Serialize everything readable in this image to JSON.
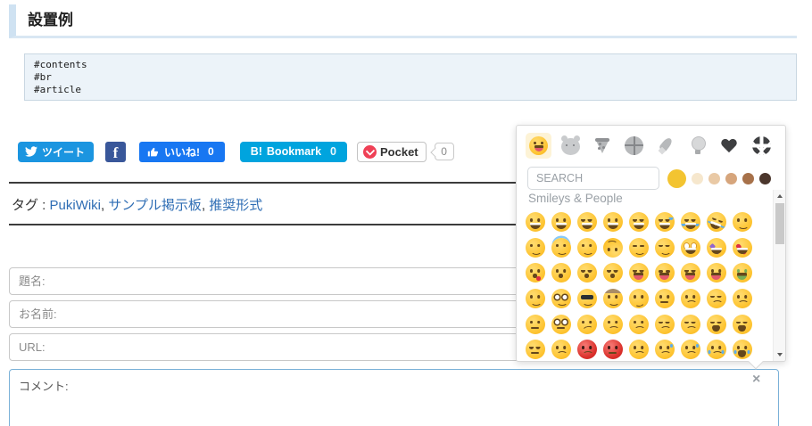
{
  "page": {
    "title": "設置例"
  },
  "code_block": {
    "lines": [
      "#contents",
      "#br",
      "#article"
    ]
  },
  "social": {
    "tweet": {
      "label": "ツイート"
    },
    "facebook": {
      "label": "f"
    },
    "like": {
      "label": "いいね!",
      "count": "0"
    },
    "hatena": {
      "brand": "B!",
      "label": "Bookmark",
      "count": "0"
    },
    "pocket": {
      "label": "Pocket",
      "count": "0"
    }
  },
  "tags": {
    "label": "タグ :",
    "separator": ", ",
    "items": [
      "PukiWiki",
      "サンプル掲示板",
      "推奨形式"
    ]
  },
  "form": {
    "fields": [
      {
        "name": "subject",
        "placeholder": "題名:"
      },
      {
        "name": "name",
        "placeholder": "お名前:"
      },
      {
        "name": "url",
        "placeholder": "URL:"
      }
    ],
    "comment": {
      "placeholder": "コメント:"
    },
    "close_label": "×"
  },
  "emoji_picker": {
    "search_placeholder": "SEARCH",
    "section_title": "Smileys & People",
    "categories": [
      {
        "name": "smileys-people",
        "icon": "smiley",
        "active": true
      },
      {
        "name": "animals-nature",
        "icon": "animal",
        "active": false
      },
      {
        "name": "food-drink",
        "icon": "food",
        "active": false
      },
      {
        "name": "activity",
        "icon": "activity",
        "active": false
      },
      {
        "name": "travel-places",
        "icon": "travel",
        "active": false
      },
      {
        "name": "objects",
        "icon": "objects",
        "active": false
      },
      {
        "name": "symbols",
        "icon": "symbols",
        "active": false
      },
      {
        "name": "flags",
        "icon": "flags",
        "active": false
      }
    ],
    "tones": [
      {
        "color": "#f3c431",
        "selected": true
      },
      {
        "color": "#f6e7cd",
        "selected": false
      },
      {
        "color": "#e9c9a5",
        "selected": false
      },
      {
        "color": "#d6a57c",
        "selected": false
      },
      {
        "color": "#a7714a",
        "selected": false
      },
      {
        "color": "#4b362c",
        "selected": false
      }
    ],
    "grid": [
      [
        {
          "n": "grinning",
          "v": "v-grin"
        },
        {
          "n": "smiley",
          "v": "v-grin"
        },
        {
          "n": "smile",
          "v": "v-laugh"
        },
        {
          "n": "grin",
          "v": "v-grin"
        },
        {
          "n": "laughing",
          "v": "v-laugh"
        },
        {
          "n": "sweat-smile",
          "v": "v-laugh v-tear"
        },
        {
          "n": "joy",
          "v": "v-laugh v-tears"
        },
        {
          "n": "rofl",
          "v": "v-laugh v-tears v-tilt"
        },
        {
          "n": "relaxed",
          "v": ""
        }
      ],
      [
        {
          "n": "blush",
          "v": ""
        },
        {
          "n": "innocent",
          "v": "v-halo"
        },
        {
          "n": "slight-smile",
          "v": ""
        },
        {
          "n": "upside-down",
          "v": "v-flip"
        },
        {
          "n": "wink",
          "v": "v-wink"
        },
        {
          "n": "relieved",
          "v": "v-calm"
        },
        {
          "n": "flushed",
          "v": "v-wide"
        },
        {
          "n": "star-struck",
          "v": "v-star"
        },
        {
          "n": "heart-eyes",
          "v": "v-heart"
        }
      ],
      [
        {
          "n": "kissing-heart",
          "v": "v-kiss v-kissheart"
        },
        {
          "n": "kissing",
          "v": "v-kiss"
        },
        {
          "n": "kissing-smiling-eyes",
          "v": "v-calm v-kiss"
        },
        {
          "n": "kissing-closed-eyes",
          "v": "v-calm v-kiss"
        },
        {
          "n": "yum",
          "v": "v-calm v-tongue"
        },
        {
          "n": "tongue-wink",
          "v": "v-wink v-tongue"
        },
        {
          "n": "tongue-closed-eyes",
          "v": "v-calm v-tongue"
        },
        {
          "n": "tongue-out",
          "v": "v-tongue"
        },
        {
          "n": "money-mouth",
          "v": "v-money"
        }
      ],
      [
        {
          "n": "hugging",
          "v": ""
        },
        {
          "n": "nerd",
          "v": "v-nerd"
        },
        {
          "n": "sunglasses",
          "v": "v-sun"
        },
        {
          "n": "cowboy",
          "v": "v-cowboy"
        },
        {
          "n": "smirk",
          "v": "v-smirk"
        },
        {
          "n": "unamused",
          "v": "v-neutral"
        },
        {
          "n": "disappointed",
          "v": "v-frown"
        },
        {
          "n": "pensive",
          "v": "v-calm v-frown"
        },
        {
          "n": "worried",
          "v": "v-frown"
        }
      ],
      [
        {
          "n": "raised-eyebrow",
          "v": "v-neutral"
        },
        {
          "n": "monocle",
          "v": "v-nerd v-neutral"
        },
        {
          "n": "confused",
          "v": "v-frown v-smirk"
        },
        {
          "n": "slight-frown",
          "v": "v-frown"
        },
        {
          "n": "frowning",
          "v": "v-frown"
        },
        {
          "n": "persevere",
          "v": "v-calm v-frown"
        },
        {
          "n": "confounded",
          "v": "v-calm v-frown"
        },
        {
          "n": "tired",
          "v": "v-calm v-wail"
        },
        {
          "n": "weary",
          "v": "v-calm v-wail"
        }
      ],
      [
        {
          "n": "triumph",
          "v": "v-calm v-neutral"
        },
        {
          "n": "angry",
          "v": "v-frown"
        },
        {
          "n": "rage",
          "v": "v-red v-frown"
        },
        {
          "n": "cursing",
          "v": "v-red v-neutral"
        },
        {
          "n": "anguished",
          "v": "v-frown"
        },
        {
          "n": "fearful",
          "v": "v-frown v-tear"
        },
        {
          "n": "cold-sweat",
          "v": "v-frown v-tear"
        },
        {
          "n": "crying",
          "v": "v-frown v-tears"
        },
        {
          "n": "sob",
          "v": "v-wail v-tears"
        }
      ]
    ]
  },
  "colors": {
    "twitter_blue": "#1b95e0",
    "facebook_blue": "#39579a",
    "like_blue": "#1877f2",
    "hatena_cyan": "#00a4de",
    "pocket_red": "#ef4056",
    "link_blue": "#2e6db4",
    "comment_border": "#7ab1d8",
    "heading_accent": "#cfe2f2"
  }
}
